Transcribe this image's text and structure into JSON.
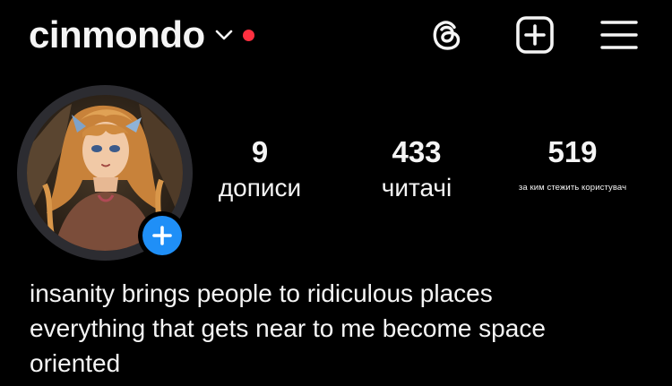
{
  "header": {
    "username": "cinmondo",
    "icons": [
      "chevron-down-icon",
      "notification-dot",
      "threads-icon",
      "create-post-icon",
      "menu-icon"
    ],
    "notification_color": "#ff3040"
  },
  "profile": {
    "avatar_icon": "anime-portrait-avatar",
    "add_story_icon": "plus-icon",
    "accent": "#1f8ff7"
  },
  "stats": [
    {
      "value": "9",
      "label": "дописи"
    },
    {
      "value": "433",
      "label": "читачі"
    },
    {
      "value": "519",
      "label": "за ким стежить користувач"
    }
  ],
  "bio": {
    "lines": [
      "insanity brings people to ridiculous places",
      "everything that gets near to me become space",
      "oriented"
    ]
  }
}
